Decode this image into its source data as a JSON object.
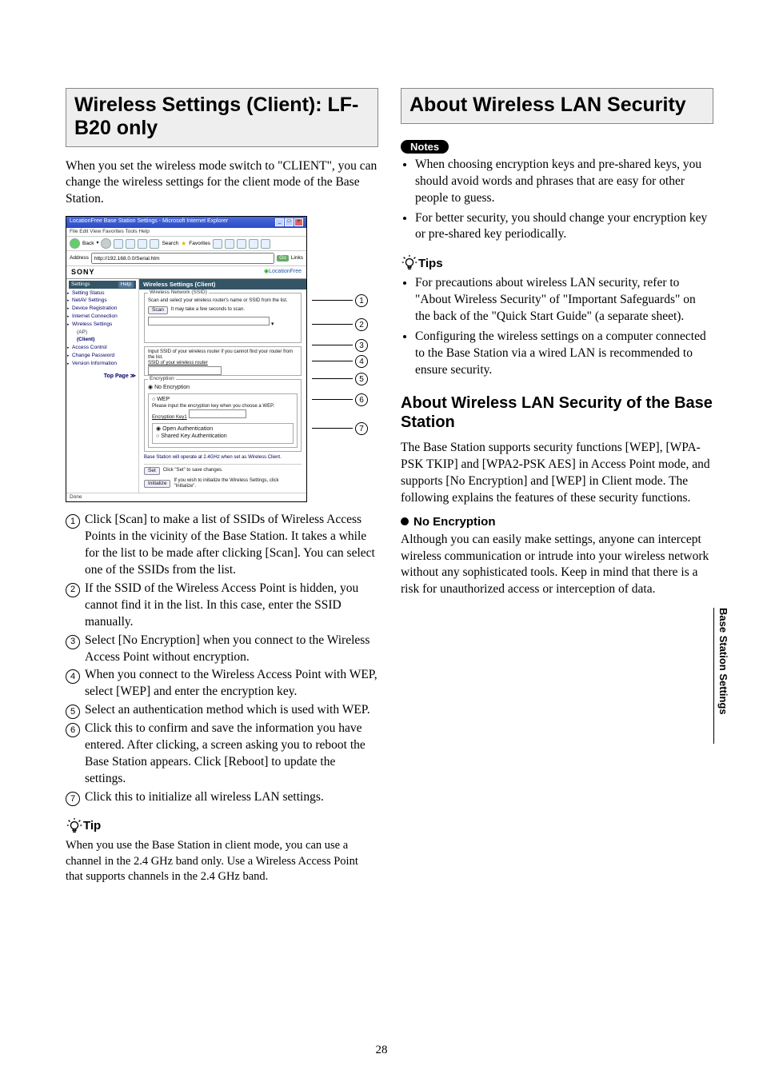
{
  "page_number": "28",
  "side_tab": "Base Station Settings",
  "left": {
    "heading": "Wireless Settings (Client): LF-B20 only",
    "intro": "When you set the wireless mode switch to \"CLIENT\", you can change the wireless settings for the client mode of the Base Station.",
    "figure": {
      "window_title": "LocationFree Base Station Settings - Microsoft Internet Explorer",
      "menubar": "File   Edit   View   Favorites   Tools   Help",
      "address_label": "Address",
      "address_value": "http://192.168.0.0/Serial.htm",
      "go_label": "Go",
      "links_label": "Links",
      "brand_left": "SONY",
      "brand_right": "LocationFree",
      "sidebar": {
        "head": "Settings",
        "help": "Help",
        "items": [
          "Setting Status",
          "NetAV Settings",
          "Device Registration",
          "Internet Connection"
        ],
        "wireless_label": "Wireless Settings",
        "wireless_sub_ap": "(AP)",
        "wireless_sub_client": "(Client)",
        "items2": [
          "Access Control",
          "Change Password",
          "Version Information"
        ],
        "top_link": "Top Page ≫"
      },
      "panel_title": "Wireless Settings (Client)",
      "section_ssid_title": "Wireless Network (SSID)",
      "ssid_hint": "Scan and select your wireless router's name or SSID from the list.",
      "scan_btn": "Scan",
      "scan_note": "It may take a few seconds to scan.",
      "manual_ssid_hint": "Input SSID of your wireless router if you cannot find your router from the list.",
      "manual_ssid_label": "SSID of your wireless router",
      "enc_title": "Encryption",
      "enc_none": "No Encryption",
      "enc_wep": "WEP",
      "enc_key_hint": "Please input the encryption key when you choose a WEP.",
      "enc_key_label": "Encryption Key1",
      "auth_open": "Open Authentication",
      "auth_shared": "Shared Key Authentication",
      "band_note": "Base Station will operate at 2.4GHz when set as Wireless Client.",
      "set_btn": "Set",
      "set_note": "Click \"Set\" to save changes.",
      "init_btn": "Initialize",
      "init_note": "If you wish to initialize the Wireless Settings, click \"Initialize\".",
      "done_label": "Done"
    },
    "callouts": [
      "1",
      "2",
      "3",
      "4",
      "5",
      "6",
      "7"
    ],
    "items": [
      "Click [Scan] to make a list of SSIDs of Wireless Access Points in the vicinity of the Base Station. It takes a while for the list to be made after clicking [Scan]. You can select one of the SSIDs from the list.",
      "If the SSID of the Wireless Access Point is hidden, you cannot find it in the list. In this case, enter the SSID manually.",
      "Select [No Encryption] when you connect to the Wireless Access Point without encryption.",
      "When you connect to the Wireless Access Point with WEP, select [WEP] and enter the encryption key.",
      "Select an authentication method which is used with WEP.",
      "Click this to confirm and save the information you have entered. After clicking, a screen asking you to reboot the Base Station appears. Click [Reboot] to update the settings.",
      "Click this to initialize all wireless LAN settings."
    ],
    "tip_label": "Tip",
    "tip_body": "When you use the Base Station in client mode, you can use a channel in the 2.4 GHz band only. Use a Wireless Access Point that supports channels in the 2.4 GHz band."
  },
  "right": {
    "heading": "About Wireless LAN Security",
    "notes_label": "Notes",
    "notes": [
      "When choosing encryption keys and pre-shared keys, you should avoid words and phrases that are easy for other people to guess.",
      "For better security, you should change your encryption key or pre-shared key periodically."
    ],
    "tips_label": "Tips",
    "tips": [
      "For precautions about wireless LAN security, refer to \"About Wireless Security\" of \"Important Safeguards\" on the back of the \"Quick Start Guide\" (a separate sheet).",
      "Configuring the wireless settings on a computer connected to the Base Station via a wired LAN is recommended to ensure security."
    ],
    "h2": "About Wireless LAN Security of the Base Station",
    "h2_body": "The Base Station supports security functions [WEP], [WPA-PSK TKIP] and [WPA2-PSK AES] in Access Point mode, and supports [No Encryption] and [WEP] in Client mode. The following explains the features of these security functions.",
    "h3": "No Encryption",
    "h3_body": "Although you can easily make settings, anyone can intercept wireless communication or intrude into your wireless network without any sophisticated tools. Keep in mind that there is a risk for unauthorized access or interception of data."
  }
}
